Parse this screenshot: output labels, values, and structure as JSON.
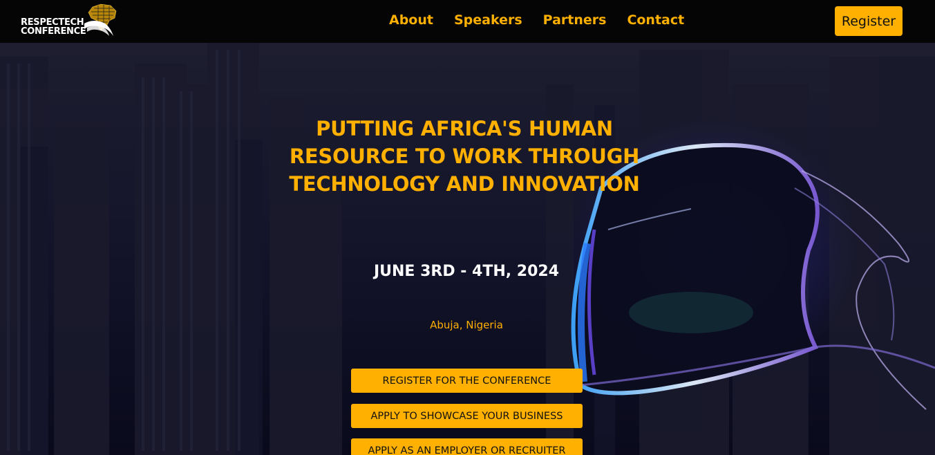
{
  "brand": {
    "line1": "RESPECTECH",
    "line2": "CONFERENCE",
    "logo_icon": "map-africa-icon",
    "text_color": "#ffffff"
  },
  "nav": {
    "items": [
      {
        "label": "About"
      },
      {
        "label": "Speakers"
      },
      {
        "label": "Partners"
      },
      {
        "label": "Contact"
      }
    ],
    "register_label": "Register"
  },
  "hero": {
    "title": "PUTTING AFRICA'S HUMAN RESOURCE TO WORK THROUGH TECHNOLOGY AND INNOVATION",
    "date": "JUNE 3RD - 4TH, 2024",
    "location": "Abuja, Nigeria",
    "buttons": [
      {
        "label": "REGISTER FOR THE CONFERENCE"
      },
      {
        "label": "APPLY TO SHOWCASE YOUR BUSINESS"
      },
      {
        "label": "APPLY AS AN EMPLOYER OR RECRUITER"
      }
    ]
  },
  "colors": {
    "accent": "#ffb000",
    "navbar_bg": "#050505",
    "hero_bg": "#0f0f22",
    "headset_glow": "#3a5bd9"
  }
}
